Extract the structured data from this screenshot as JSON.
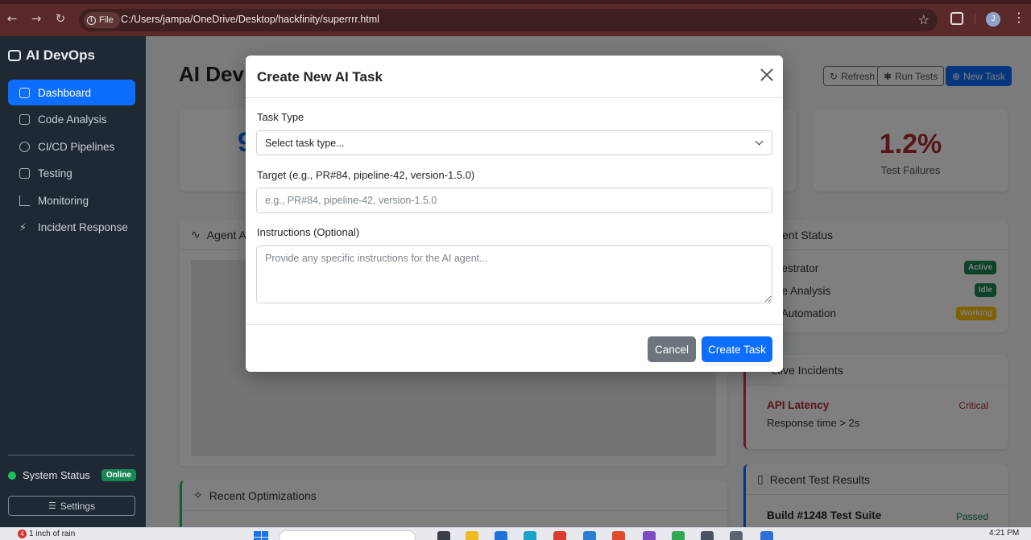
{
  "browser": {
    "file_chip": "File",
    "url": "C:/Users/jampa/OneDrive/Desktop/hackfinity/superrrr.html",
    "profile_initial": "J"
  },
  "sidebar": {
    "brand": "AI DevOps",
    "items": [
      {
        "label": "Dashboard",
        "active": true
      },
      {
        "label": "Code Analysis"
      },
      {
        "label": "CI/CD Pipelines"
      },
      {
        "label": "Testing"
      },
      {
        "label": "Monitoring"
      },
      {
        "label": "Incident Response"
      }
    ],
    "system_status_label": "System Status",
    "system_status_badge": "Online",
    "settings_label": "Settings"
  },
  "main": {
    "title": "AI Dev",
    "toolbar": {
      "refresh": "Refresh",
      "run_tests": "Run Tests",
      "new_task": "New Task"
    },
    "stat_partial": "9",
    "test_failures": {
      "value": "1.2%",
      "label": "Test Failures"
    },
    "agent_activity_title": "Agent A",
    "agent_status_title": "ent Status",
    "agents": [
      {
        "name": "hestrator",
        "status": "Active",
        "color": "#198754"
      },
      {
        "name": "de Analysis",
        "status": "Idle",
        "color": "#198754"
      },
      {
        "name": "t Automation",
        "status": "Working",
        "color": "#ffc107"
      }
    ],
    "incidents_title": "ctive Incidents",
    "incident": {
      "name": "API Latency",
      "severity": "Critical",
      "detail": "Response time > 2s"
    },
    "optimizations_title": "Recent Optimizations",
    "tests_title": "Recent Test Results",
    "test_result": {
      "name": "Build #1248 Test Suite",
      "status": "Passed"
    }
  },
  "modal": {
    "title": "Create New AI Task",
    "task_type_label": "Task Type",
    "task_type_value": "Select task type...",
    "target_label": "Target (e.g., PR#84, pipeline-42, version-1.5.0)",
    "target_placeholder": "e.g., PR#84, pipeline-42, version-1.5.0",
    "instructions_label": "Instructions (Optional)",
    "instructions_placeholder": "Provide any specific instructions for the AI agent...",
    "cancel_label": "Cancel",
    "create_label": "Create Task"
  },
  "taskbar": {
    "weather_badge": "4",
    "weather_text": "1 inch of rain",
    "time": "4:21 PM"
  }
}
